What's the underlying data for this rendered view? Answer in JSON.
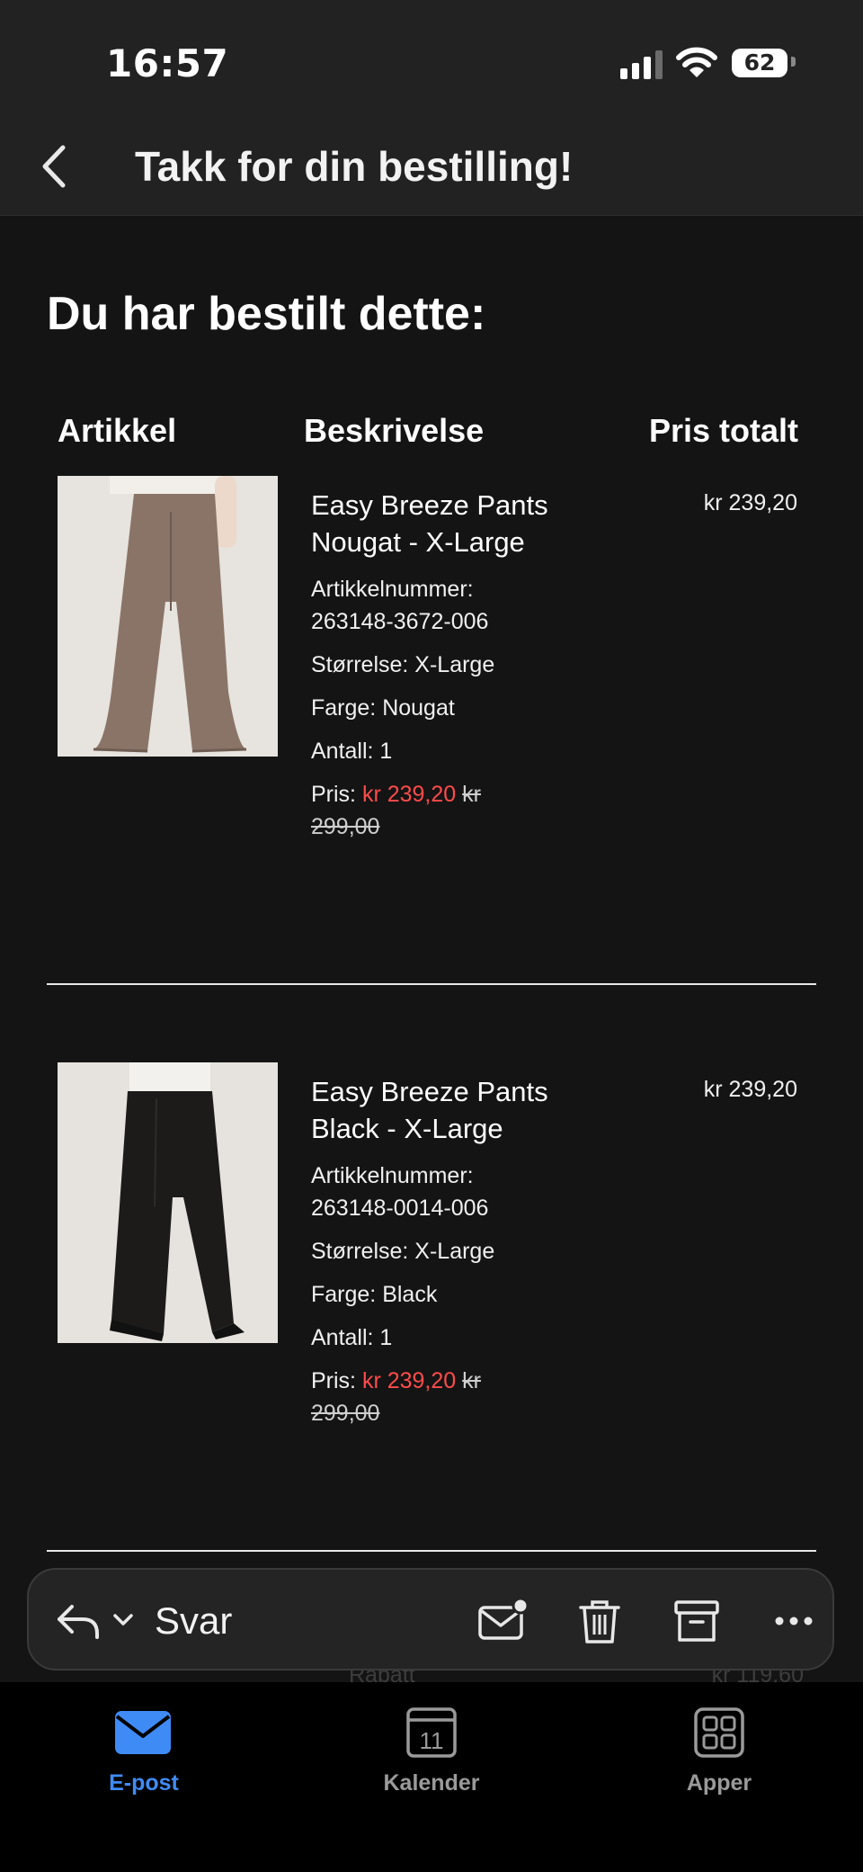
{
  "status_bar": {
    "time": "16:57",
    "battery": "62"
  },
  "header": {
    "title": "Takk for din bestilling!"
  },
  "order": {
    "section_title": "Du har bestilt dette:",
    "columns": {
      "article": "Artikkel",
      "description": "Beskrivelse",
      "total": "Pris totalt"
    },
    "items": [
      {
        "name": "Easy Breeze Pants Nougat - X-Large",
        "article_number_label": "Artikkelnummer:",
        "article_number": "263148-3672-006",
        "size": "Størrelse: X-Large",
        "color": "Farge: Nougat",
        "quantity": "Antall: 1",
        "price_label": "Pris:",
        "price_sale": "kr 239,20",
        "price_old": "kr 299,00",
        "total": "kr 239,20",
        "swatch": "#8a7468"
      },
      {
        "name": "Easy Breeze Pants Black - X-Large",
        "article_number_label": "Artikkelnummer:",
        "article_number": "263148-0014-006",
        "size": "Størrelse: X-Large",
        "color": "Farge: Black",
        "quantity": "Antall: 1",
        "price_label": "Pris:",
        "price_sale": "kr 239,20",
        "price_old": "kr 299,00",
        "total": "kr 239,20",
        "swatch": "#1c1b1a"
      }
    ],
    "discount_label": "Rabatt",
    "discount_value": "kr 119,60"
  },
  "toolbar": {
    "reply_label": "Svar"
  },
  "tabbar": {
    "tabs": [
      {
        "label": "E-post",
        "active": true
      },
      {
        "label": "Kalender",
        "active": false,
        "day": "11"
      },
      {
        "label": "Apper",
        "active": false
      }
    ]
  },
  "colors": {
    "accent": "#3f8bf5",
    "sale": "#ff4b4b",
    "background": "#141414",
    "header": "#222222"
  }
}
